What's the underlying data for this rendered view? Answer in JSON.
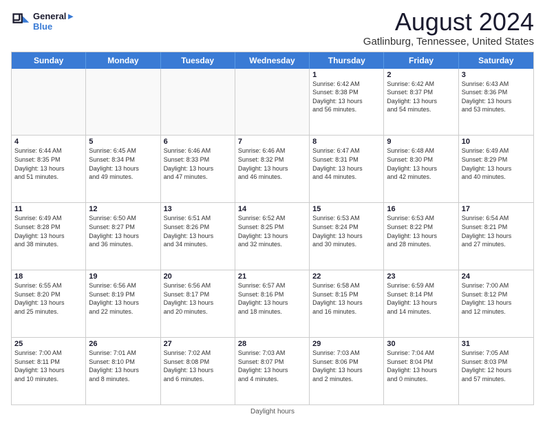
{
  "logo": {
    "line1": "General",
    "line2": "Blue"
  },
  "title": "August 2024",
  "subtitle": "Gatlinburg, Tennessee, United States",
  "days_of_week": [
    "Sunday",
    "Monday",
    "Tuesday",
    "Wednesday",
    "Thursday",
    "Friday",
    "Saturday"
  ],
  "footer": "Daylight hours",
  "weeks": [
    [
      {
        "day": "",
        "text": "",
        "empty": true
      },
      {
        "day": "",
        "text": "",
        "empty": true
      },
      {
        "day": "",
        "text": "",
        "empty": true
      },
      {
        "day": "",
        "text": "",
        "empty": true
      },
      {
        "day": "1",
        "text": "Sunrise: 6:42 AM\nSunset: 8:38 PM\nDaylight: 13 hours\nand 56 minutes."
      },
      {
        "day": "2",
        "text": "Sunrise: 6:42 AM\nSunset: 8:37 PM\nDaylight: 13 hours\nand 54 minutes."
      },
      {
        "day": "3",
        "text": "Sunrise: 6:43 AM\nSunset: 8:36 PM\nDaylight: 13 hours\nand 53 minutes."
      }
    ],
    [
      {
        "day": "4",
        "text": "Sunrise: 6:44 AM\nSunset: 8:35 PM\nDaylight: 13 hours\nand 51 minutes."
      },
      {
        "day": "5",
        "text": "Sunrise: 6:45 AM\nSunset: 8:34 PM\nDaylight: 13 hours\nand 49 minutes."
      },
      {
        "day": "6",
        "text": "Sunrise: 6:46 AM\nSunset: 8:33 PM\nDaylight: 13 hours\nand 47 minutes."
      },
      {
        "day": "7",
        "text": "Sunrise: 6:46 AM\nSunset: 8:32 PM\nDaylight: 13 hours\nand 46 minutes."
      },
      {
        "day": "8",
        "text": "Sunrise: 6:47 AM\nSunset: 8:31 PM\nDaylight: 13 hours\nand 44 minutes."
      },
      {
        "day": "9",
        "text": "Sunrise: 6:48 AM\nSunset: 8:30 PM\nDaylight: 13 hours\nand 42 minutes."
      },
      {
        "day": "10",
        "text": "Sunrise: 6:49 AM\nSunset: 8:29 PM\nDaylight: 13 hours\nand 40 minutes."
      }
    ],
    [
      {
        "day": "11",
        "text": "Sunrise: 6:49 AM\nSunset: 8:28 PM\nDaylight: 13 hours\nand 38 minutes."
      },
      {
        "day": "12",
        "text": "Sunrise: 6:50 AM\nSunset: 8:27 PM\nDaylight: 13 hours\nand 36 minutes."
      },
      {
        "day": "13",
        "text": "Sunrise: 6:51 AM\nSunset: 8:26 PM\nDaylight: 13 hours\nand 34 minutes."
      },
      {
        "day": "14",
        "text": "Sunrise: 6:52 AM\nSunset: 8:25 PM\nDaylight: 13 hours\nand 32 minutes."
      },
      {
        "day": "15",
        "text": "Sunrise: 6:53 AM\nSunset: 8:24 PM\nDaylight: 13 hours\nand 30 minutes."
      },
      {
        "day": "16",
        "text": "Sunrise: 6:53 AM\nSunset: 8:22 PM\nDaylight: 13 hours\nand 28 minutes."
      },
      {
        "day": "17",
        "text": "Sunrise: 6:54 AM\nSunset: 8:21 PM\nDaylight: 13 hours\nand 27 minutes."
      }
    ],
    [
      {
        "day": "18",
        "text": "Sunrise: 6:55 AM\nSunset: 8:20 PM\nDaylight: 13 hours\nand 25 minutes."
      },
      {
        "day": "19",
        "text": "Sunrise: 6:56 AM\nSunset: 8:19 PM\nDaylight: 13 hours\nand 22 minutes."
      },
      {
        "day": "20",
        "text": "Sunrise: 6:56 AM\nSunset: 8:17 PM\nDaylight: 13 hours\nand 20 minutes."
      },
      {
        "day": "21",
        "text": "Sunrise: 6:57 AM\nSunset: 8:16 PM\nDaylight: 13 hours\nand 18 minutes."
      },
      {
        "day": "22",
        "text": "Sunrise: 6:58 AM\nSunset: 8:15 PM\nDaylight: 13 hours\nand 16 minutes."
      },
      {
        "day": "23",
        "text": "Sunrise: 6:59 AM\nSunset: 8:14 PM\nDaylight: 13 hours\nand 14 minutes."
      },
      {
        "day": "24",
        "text": "Sunrise: 7:00 AM\nSunset: 8:12 PM\nDaylight: 13 hours\nand 12 minutes."
      }
    ],
    [
      {
        "day": "25",
        "text": "Sunrise: 7:00 AM\nSunset: 8:11 PM\nDaylight: 13 hours\nand 10 minutes."
      },
      {
        "day": "26",
        "text": "Sunrise: 7:01 AM\nSunset: 8:10 PM\nDaylight: 13 hours\nand 8 minutes."
      },
      {
        "day": "27",
        "text": "Sunrise: 7:02 AM\nSunset: 8:08 PM\nDaylight: 13 hours\nand 6 minutes."
      },
      {
        "day": "28",
        "text": "Sunrise: 7:03 AM\nSunset: 8:07 PM\nDaylight: 13 hours\nand 4 minutes."
      },
      {
        "day": "29",
        "text": "Sunrise: 7:03 AM\nSunset: 8:06 PM\nDaylight: 13 hours\nand 2 minutes."
      },
      {
        "day": "30",
        "text": "Sunrise: 7:04 AM\nSunset: 8:04 PM\nDaylight: 13 hours\nand 0 minutes."
      },
      {
        "day": "31",
        "text": "Sunrise: 7:05 AM\nSunset: 8:03 PM\nDaylight: 12 hours\nand 57 minutes."
      }
    ]
  ]
}
